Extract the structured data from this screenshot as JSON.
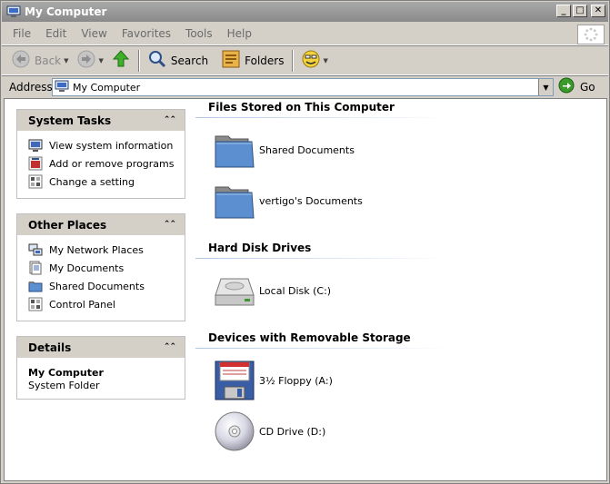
{
  "window": {
    "title": "My Computer",
    "buttons": {
      "minimize": "_",
      "maximize": "□",
      "close": "✕"
    }
  },
  "menu": [
    "File",
    "Edit",
    "View",
    "Favorites",
    "Tools",
    "Help"
  ],
  "toolbar": {
    "back_label": "Back",
    "search_label": "Search",
    "folders_label": "Folders"
  },
  "address": {
    "label": "Address",
    "value": "My Computer",
    "go_label": "Go"
  },
  "system_tasks": {
    "title": "System Tasks",
    "items": [
      {
        "label": "View system information",
        "icon": "monitor-icon"
      },
      {
        "label": "Add or remove programs",
        "icon": "add-remove-programs-icon"
      },
      {
        "label": "Change a setting",
        "icon": "control-panel-icon"
      }
    ]
  },
  "other_places": {
    "title": "Other Places",
    "items": [
      {
        "label": "My Network Places",
        "icon": "network-places-icon"
      },
      {
        "label": "My Documents",
        "icon": "documents-icon"
      },
      {
        "label": "Shared Documents",
        "icon": "folder-icon"
      },
      {
        "label": "Control Panel",
        "icon": "control-panel-icon"
      }
    ]
  },
  "details": {
    "title": "Details",
    "name": "My Computer",
    "type": "System Folder"
  },
  "sections": {
    "files": {
      "title": "Files Stored on This Computer",
      "items": [
        "Shared Documents",
        "vertigo's Documents"
      ]
    },
    "drives": {
      "title": "Hard Disk Drives",
      "items": [
        "Local Disk (C:)"
      ]
    },
    "removable": {
      "title": "Devices with Removable Storage",
      "items": [
        "3½ Floppy (A:)",
        "CD Drive (D:)"
      ]
    }
  },
  "colors": {
    "folder_blue": "#5b8fd0",
    "panel_header": "#d4d0c8",
    "go_green": "#3a9a2a"
  }
}
